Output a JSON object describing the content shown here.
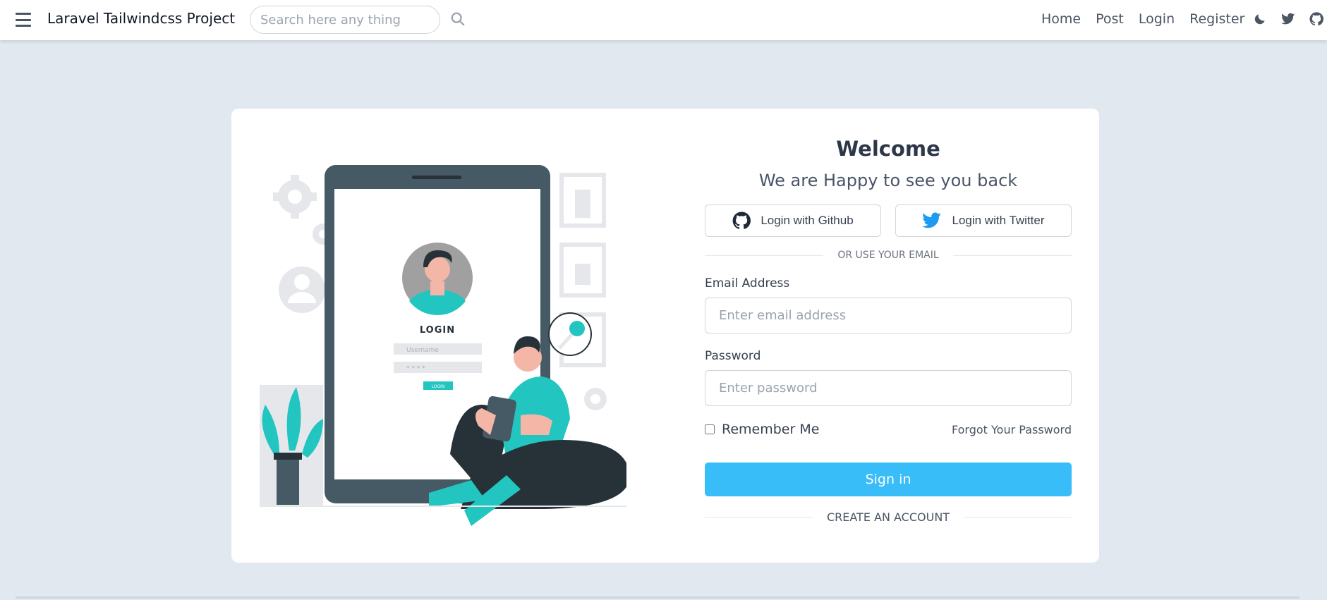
{
  "navbar": {
    "brand": "Laravel Tailwindcss Project",
    "search_placeholder": "Search here any thing",
    "links": [
      "Home",
      "Post",
      "Login",
      "Register"
    ]
  },
  "illustration": {
    "screen_title": "LOGIN",
    "username_placeholder": "Username",
    "password_mask": "* * * *",
    "button": "LOGIN"
  },
  "form": {
    "welcome": "Welcome",
    "subtitle": "We are Happy to see you back",
    "github_label": "Login with Github",
    "twitter_label": "Login with Twitter",
    "divider": "OR USE YOUR EMAIL",
    "email_label": "Email Address",
    "email_placeholder": "Enter email address",
    "password_label": "Password",
    "password_placeholder": "Enter password",
    "remember_label": "Remember Me",
    "forgot_label": "Forgot Your Password",
    "signin_label": "Sign in",
    "create_label": "CREATE AN ACCOUNT"
  },
  "colors": {
    "accent": "#38bdf8",
    "teal": "#22c5c0",
    "dark": "#455a64",
    "background": "#e2e8f0"
  },
  "icons": [
    "menu-icon",
    "search-icon",
    "moon-icon",
    "twitter-icon",
    "github-icon"
  ]
}
